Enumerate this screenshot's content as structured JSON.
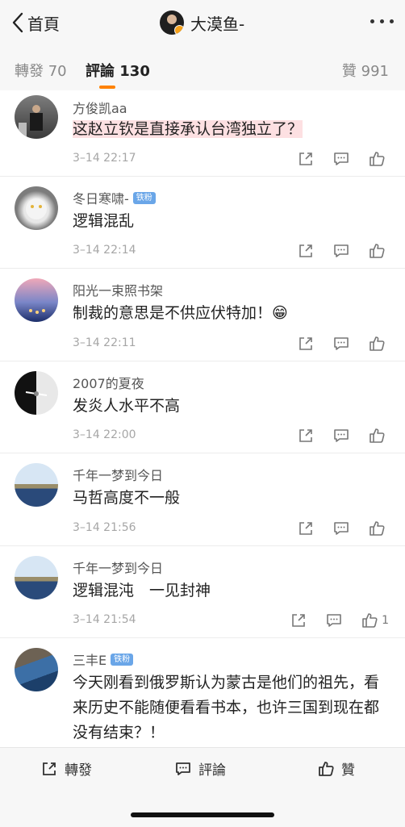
{
  "header": {
    "back_label": "首頁",
    "author_name": "大漠鱼-",
    "icons": [
      "chevron-left-icon",
      "verified-badge-icon",
      "more-dots-icon"
    ]
  },
  "tabs": {
    "repost": "轉發 70",
    "comments": "評論 130",
    "likes": "贊 991",
    "active": "comments",
    "accent_color": "#ff8200"
  },
  "comments": [
    {
      "name": "方俊凯aa",
      "text": "这赵立钦是直接承认台湾独立了？",
      "time": "3–14 22:17",
      "badge": "",
      "likes": "",
      "highlight": true
    },
    {
      "name": "冬日寒啸-",
      "text": "逻辑混乱",
      "time": "3–14 22:14",
      "badge": "铁粉",
      "likes": ""
    },
    {
      "name": "阳光一束照书架",
      "text": "制裁的意思是不供应伏特加！😁",
      "time": "3–14 22:11",
      "badge": "",
      "likes": ""
    },
    {
      "name": "2007的夏夜",
      "text": "发炎人水平不高",
      "time": "3–14 22:00",
      "badge": "",
      "likes": ""
    },
    {
      "name": "千年一梦到今日",
      "text": "马哲高度不一般",
      "time": "3–14 21:56",
      "badge": "",
      "likes": ""
    },
    {
      "name": "千年一梦到今日",
      "text": "逻辑混沌　一见封神",
      "time": "3–14 21:54",
      "badge": "",
      "likes": "1"
    },
    {
      "name": "三丰E",
      "text": "今天刚看到俄罗斯认为蒙古是他们的祖先，看来历史不能随便看看书本，也许三国到现在都没有结束？！",
      "time": "",
      "badge": "铁粉",
      "likes": ""
    }
  ],
  "bottom_bar": {
    "repost": "轉發",
    "comment": "評論",
    "like": "贊"
  }
}
